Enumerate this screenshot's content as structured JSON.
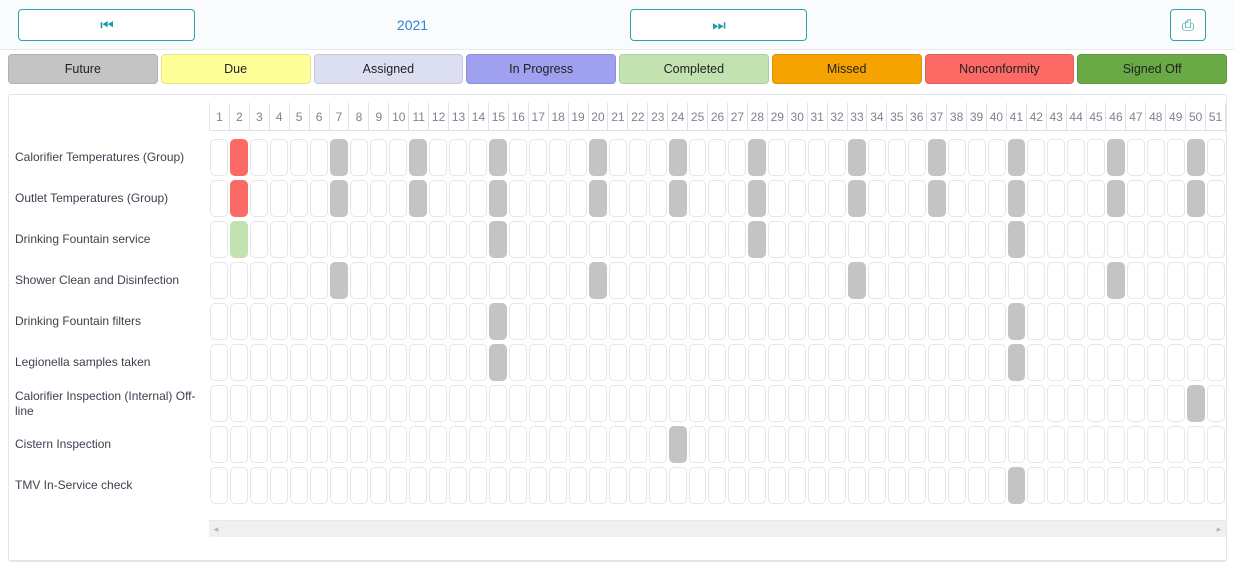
{
  "toolbar": {
    "prev_label": "⏮",
    "prev_name": "skip-backward-icon",
    "next_label": "⏭",
    "next_name": "skip-forward-icon",
    "year": "2021",
    "print_label": "⎙",
    "print_name": "printer-icon"
  },
  "legend": [
    {
      "label": "Future",
      "color": "#c4c4c4"
    },
    {
      "label": "Due",
      "color": "#ffff99"
    },
    {
      "label": "Assigned",
      "color": "#dcdff2"
    },
    {
      "label": "In Progress",
      "color": "#9fa0ef"
    },
    {
      "label": "Completed",
      "color": "#c3e2b2"
    },
    {
      "label": "Missed",
      "color": "#f5a300"
    },
    {
      "label": "Nonconformity",
      "color": "#fb6a64"
    },
    {
      "label": "Signed Off",
      "color": "#6aaa46"
    }
  ],
  "grid": {
    "weeks": [
      1,
      2,
      3,
      4,
      5,
      6,
      7,
      8,
      9,
      10,
      11,
      12,
      13,
      14,
      15,
      16,
      17,
      18,
      19,
      20,
      21,
      22,
      23,
      24,
      25,
      26,
      27,
      28,
      29,
      30,
      31,
      32,
      33,
      34,
      35,
      36,
      37,
      38,
      39,
      40,
      41,
      42,
      43,
      44,
      45,
      46,
      47,
      48,
      49,
      50,
      51
    ],
    "first_week": 1,
    "last_week": 51,
    "rows": [
      {
        "label": "Calorifier Temperatures (Group)",
        "cells": {
          "2": "nonconformity",
          "7": "future",
          "11": "future",
          "15": "future",
          "20": "future",
          "24": "future",
          "28": "future",
          "33": "future",
          "37": "future",
          "41": "future",
          "46": "future",
          "50": "future"
        }
      },
      {
        "label": "Outlet Temperatures (Group)",
        "cells": {
          "2": "nonconformity",
          "7": "future",
          "11": "future",
          "15": "future",
          "20": "future",
          "24": "future",
          "28": "future",
          "33": "future",
          "37": "future",
          "41": "future",
          "46": "future",
          "50": "future"
        }
      },
      {
        "label": "Drinking Fountain service",
        "cells": {
          "2": "completed",
          "15": "future",
          "28": "future",
          "41": "future"
        }
      },
      {
        "label": "Shower Clean and Disinfection",
        "cells": {
          "7": "future",
          "20": "future",
          "33": "future",
          "46": "future"
        }
      },
      {
        "label": "Drinking Fountain filters",
        "cells": {
          "15": "future",
          "41": "future"
        }
      },
      {
        "label": "Legionella samples taken",
        "cells": {
          "15": "future",
          "41": "future"
        }
      },
      {
        "label": "Calorifier Inspection (Internal) Off-line",
        "cells": {
          "50": "future"
        }
      },
      {
        "label": "Cistern Inspection",
        "cells": {
          "24": "future"
        }
      },
      {
        "label": "TMV In-Service check",
        "cells": {
          "41": "future"
        }
      }
    ]
  },
  "scrollbar": {
    "left_arrow": "◂",
    "right_arrow": "▸"
  }
}
